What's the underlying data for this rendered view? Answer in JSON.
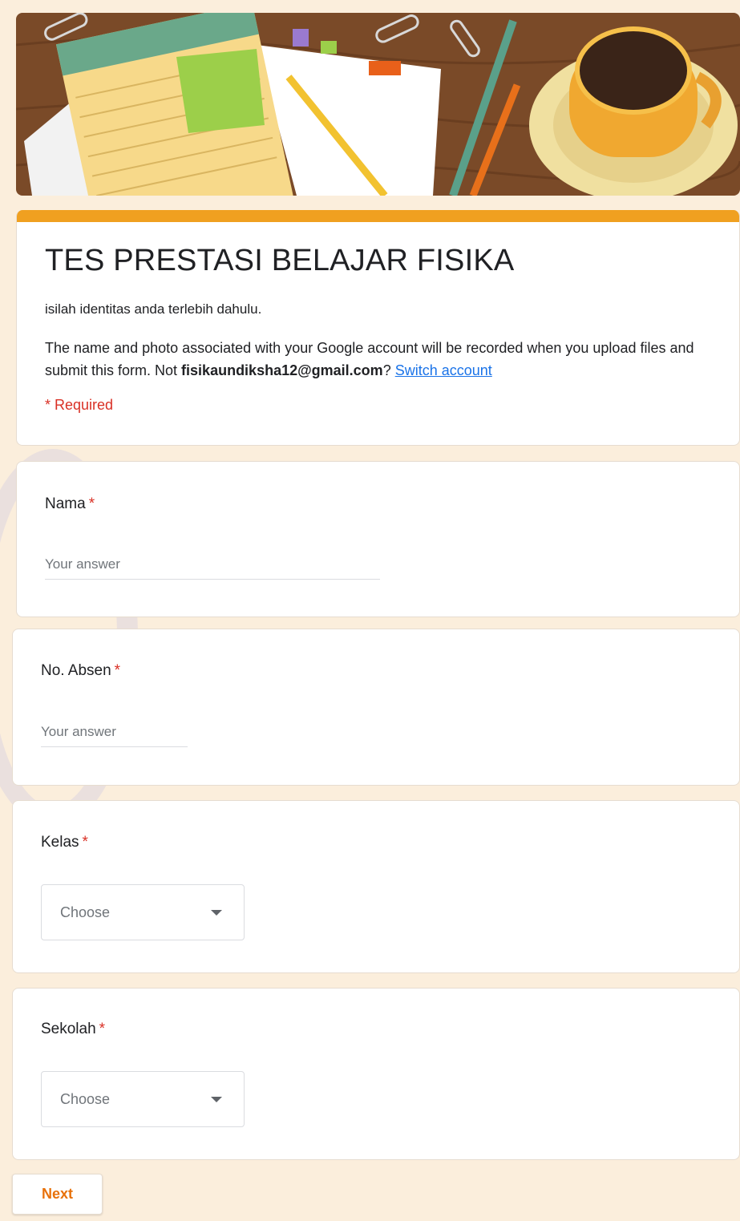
{
  "form": {
    "title": "TES PRESTASI BELAJAR FISIKA",
    "description": "isilah identitas anda terlebih dahulu.",
    "account_notice_prefix": "The name and photo associated with your Google account will be recorded when you upload files and submit this form. Not ",
    "account_email": "fisikaundiksha12@gmail.com",
    "account_notice_suffix": "? ",
    "switch_account_label": "Switch account",
    "required_note": "* Required"
  },
  "questions": {
    "nama": {
      "label": "Nama",
      "required_mark": "*",
      "placeholder": "Your answer"
    },
    "absen": {
      "label": "No. Absen",
      "required_mark": "*",
      "placeholder": "Your answer"
    },
    "kelas": {
      "label": "Kelas",
      "required_mark": "*",
      "selected": "Choose"
    },
    "sekolah": {
      "label": "Sekolah",
      "required_mark": "*",
      "selected": "Choose"
    }
  },
  "navigation": {
    "next_label": "Next"
  },
  "colors": {
    "accent": "#f0a020",
    "required": "#d93025",
    "link": "#1a73e8",
    "next_text": "#e8710a",
    "background": "#fbeedc"
  }
}
